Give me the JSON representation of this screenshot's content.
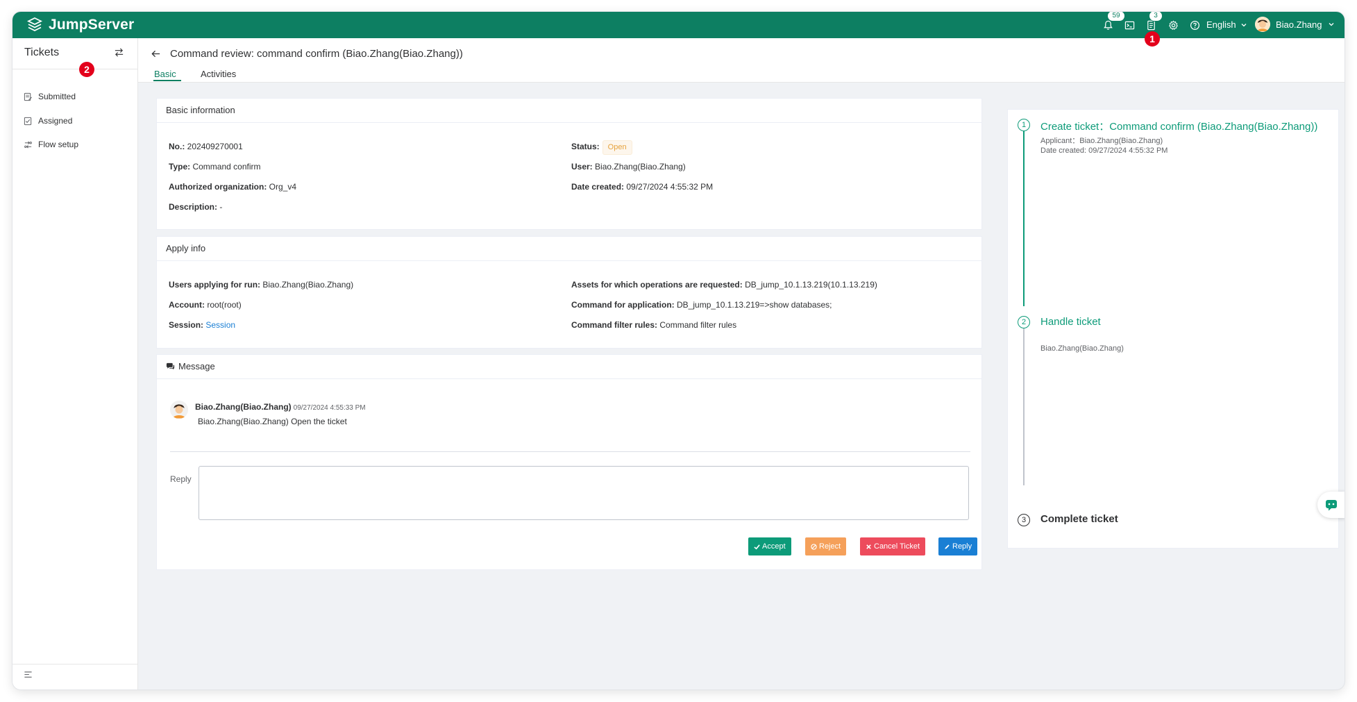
{
  "brand": {
    "name": "JumpServer"
  },
  "topbar": {
    "notifications_count": "59",
    "tickets_count": "3",
    "language": "English",
    "user": "Biao.Zhang"
  },
  "marks": {
    "one": "1",
    "two": "2"
  },
  "sidebar": {
    "title": "Tickets",
    "items": [
      {
        "label": "Submitted"
      },
      {
        "label": "Assigned"
      },
      {
        "label": "Flow setup"
      }
    ]
  },
  "page": {
    "title": "Command review: command confirm (Biao.Zhang(Biao.Zhang))",
    "tabs": [
      {
        "label": "Basic"
      },
      {
        "label": "Activities"
      }
    ]
  },
  "basic": {
    "title": "Basic information",
    "no_label": "No.:",
    "no_value": "202409270001",
    "type_label": "Type:",
    "type_value": "Command confirm",
    "org_label": "Authorized organization:",
    "org_value": "Org_v4",
    "desc_label": "Description:",
    "desc_value": "-",
    "status_label": "Status:",
    "status_value": "Open",
    "user_label": "User:",
    "user_value": "Biao.Zhang(Biao.Zhang)",
    "created_label": "Date created:",
    "created_value": "09/27/2024 4:55:32 PM"
  },
  "apply": {
    "title": "Apply info",
    "users_label": "Users applying for run:",
    "users_value": "Biao.Zhang(Biao.Zhang)",
    "account_label": "Account:",
    "account_value": "root(root)",
    "session_label": "Session:",
    "session_value": "Session",
    "assets_label": "Assets for which operations are requested:",
    "assets_value": "DB_jump_10.1.13.219(10.1.13.219)",
    "command_label": "Command for application:",
    "command_value": "DB_jump_10.1.13.219=>show databases;",
    "filter_label": "Command filter rules:",
    "filter_value": "Command filter rules"
  },
  "message": {
    "title": "Message",
    "author": "Biao.Zhang(Biao.Zhang)",
    "time": "09/27/2024 4:55:33 PM",
    "text": "Biao.Zhang(Biao.Zhang) Open the ticket",
    "reply_label": "Reply",
    "reply_value": ""
  },
  "buttons": {
    "accept": "Accept",
    "reject": "Reject",
    "cancel": "Cancel Ticket",
    "reply": "Reply"
  },
  "colors": {
    "brand": "#0d7f62",
    "accept": "#0d9b79",
    "reject": "#f5a05a",
    "cancel": "#ed4b5c",
    "reply": "#1a7fd4"
  },
  "timeline": {
    "steps": [
      {
        "number": "1",
        "title": "Create ticket：Command confirm (Biao.Zhang(Biao.Zhang))",
        "applicant": "Applicant：Biao.Zhang(Biao.Zhang)",
        "date": "Date created: 09/27/2024 4:55:32 PM"
      },
      {
        "number": "2",
        "title": "Handle ticket",
        "assignee": "Biao.Zhang(Biao.Zhang)"
      },
      {
        "number": "3",
        "title": "Complete ticket"
      }
    ]
  }
}
